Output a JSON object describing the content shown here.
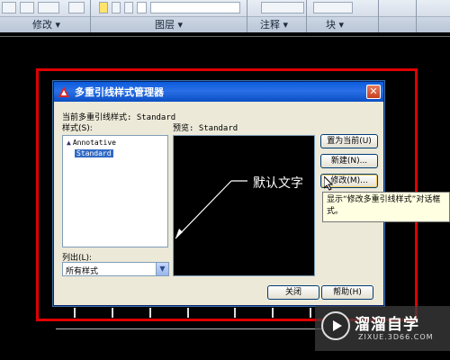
{
  "ribbon": {
    "panels": [
      {
        "label": "修改 ▾"
      },
      {
        "label": "图层 ▾"
      },
      {
        "label": "注释 ▾"
      },
      {
        "label": "块 ▾"
      }
    ]
  },
  "dialog": {
    "title": "多重引线样式管理器",
    "current_style": "当前多重引线样式: Standard",
    "styles_label": "样式(S):",
    "preview_label": "预览: Standard",
    "styles": [
      {
        "label": "Annotative",
        "icon": "annotative-icon",
        "selected": false
      },
      {
        "label": "Standard",
        "selected": true
      }
    ],
    "list_label": "列出(L):",
    "list_value": "所有样式",
    "buttons": {
      "set_current": "置为当前(U)",
      "new": "新建(N)...",
      "modify": "修改(M)...",
      "close": "关闭",
      "help": "帮助(H)"
    }
  },
  "preview_annotation": "默认文字",
  "tooltip": {
    "line1": "显示“修改多重引线样式”对话框",
    "line2": "式。"
  },
  "watermark": {
    "name": "溜溜自学",
    "url": "ZIXUE.3D66.COM"
  },
  "colors": {
    "highlight_frame": "#e00000",
    "title_bar": "#0a5cdd",
    "selection": "#316ac5"
  }
}
